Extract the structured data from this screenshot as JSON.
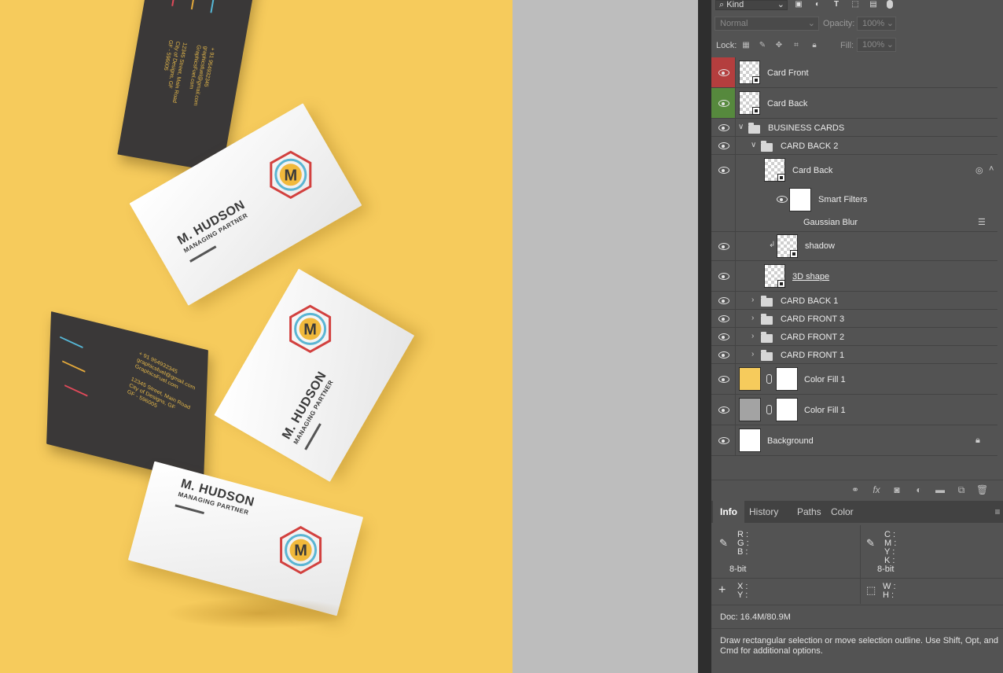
{
  "colors": {
    "canvas_bg": "#f6cb5c",
    "pasteboard": "#bdbdbd",
    "panel_bg": "#535353",
    "eye_red": "#b43e3e",
    "eye_green": "#56893d",
    "fill_yellow": "#f6cb5c",
    "fill_gray": "#a3a3a3"
  },
  "canvas": {
    "card_name": "M. HUDSON",
    "card_title": "MANAGING PARTNER",
    "logo_letter": "M",
    "contact_lines": [
      "+ 91 954932345",
      "graphicsfuel@gmail.com",
      "GraphicsFuel.com",
      "12345 Street, Main Road",
      "City of Designs, GF",
      "GF - 596005"
    ]
  },
  "panel": {
    "filter": {
      "kind_label": "Kind",
      "icon_names": [
        "image-filter-icon",
        "adjustment-filter-icon",
        "type-filter-icon",
        "shape-filter-icon",
        "smart-object-filter-icon",
        "filter-toggle-icon"
      ]
    },
    "blend_mode": "Normal",
    "opacity_label": "Opacity:",
    "opacity_value": "100%",
    "lock_label": "Lock:",
    "fill_label": "Fill:",
    "fill_value": "100%",
    "layers": [
      {
        "name": "Card Front",
        "type": "smart-object",
        "eye_color": "red"
      },
      {
        "name": "Card Back",
        "type": "smart-object",
        "eye_color": "green"
      },
      {
        "name": "BUSINESS CARDS",
        "type": "group",
        "expanded": true
      },
      {
        "name": "CARD BACK 2",
        "type": "group",
        "expanded": true
      },
      {
        "name": "Card Back",
        "type": "smart-object"
      },
      {
        "name": "Smart Filters",
        "type": "filter-mask"
      },
      {
        "name": "Gaussian Blur",
        "type": "filter"
      },
      {
        "name": "shadow",
        "type": "shape",
        "clipped": true
      },
      {
        "name": "3D shape",
        "type": "shape"
      },
      {
        "name": "CARD BACK 1",
        "type": "group"
      },
      {
        "name": "CARD FRONT 3",
        "type": "group"
      },
      {
        "name": "CARD FRONT 2",
        "type": "group"
      },
      {
        "name": "CARD FRONT 1",
        "type": "group"
      },
      {
        "name": "Color Fill 1",
        "type": "fill",
        "swatch": "yellow"
      },
      {
        "name": "Color Fill 1",
        "type": "fill",
        "swatch": "gray"
      },
      {
        "name": "Background",
        "type": "background",
        "locked": true
      }
    ],
    "tabs": [
      "Info",
      "History",
      "Paths",
      "Color"
    ],
    "info": {
      "rgb_labels": "R :\nG :\nB :",
      "cmyk_labels": "C :\nM :\nY :\nK :",
      "bit_left": "8-bit",
      "bit_right": "8-bit",
      "xy_labels": "X :\nY :",
      "wh_labels": "W :\nH :",
      "doc": "Doc: 16.4M/80.9M",
      "hint": "Draw rectangular selection or move selection outline.  Use Shift, Opt, and Cmd for additional options."
    }
  }
}
